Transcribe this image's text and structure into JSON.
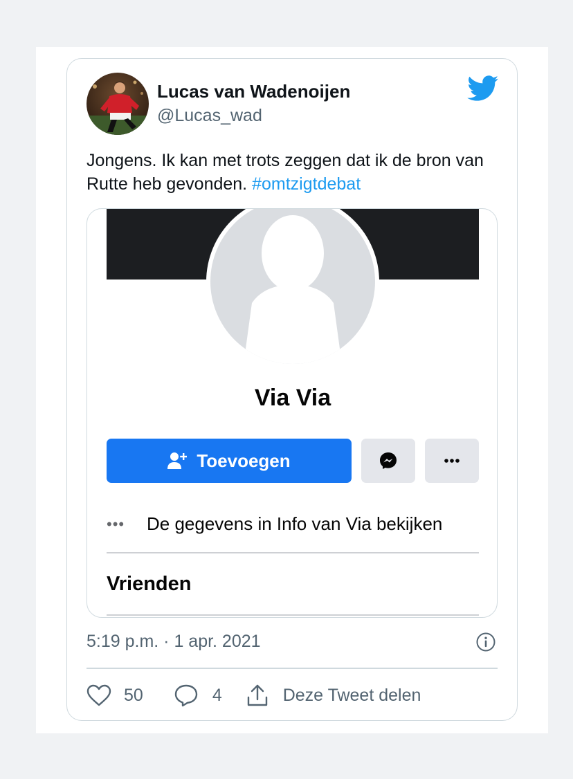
{
  "tweet": {
    "author_name": "Lucas van Wadenoijen",
    "author_handle": "@Lucas_wad",
    "text": "Jongens. Ik kan met trots zeggen dat ik de bron van Rutte heb gevonden.",
    "hashtag": "#omtzigtdebat",
    "timestamp": "5:19 p.m. · 1 apr. 2021",
    "likes": "50",
    "replies": "4",
    "share_label": "Deze Tweet delen",
    "icons": {
      "brand": "twitter-bird-icon",
      "info": "info-circle-icon",
      "like": "heart-icon",
      "reply": "speech-bubble-icon",
      "share": "share-upload-icon"
    },
    "colors": {
      "link": "#1d9bf0",
      "brand": "#1d9bf0"
    }
  },
  "facebook_card": {
    "profile_name": "Via Via",
    "add_button_label": "Toevoegen",
    "info_text": "De gegevens in Info van Via bekijken",
    "friends_title": "Vrienden",
    "icons": {
      "add": "add-friend-icon",
      "message": "messenger-icon",
      "more": "more-dots-icon"
    },
    "colors": {
      "primary": "#1877f2"
    }
  }
}
